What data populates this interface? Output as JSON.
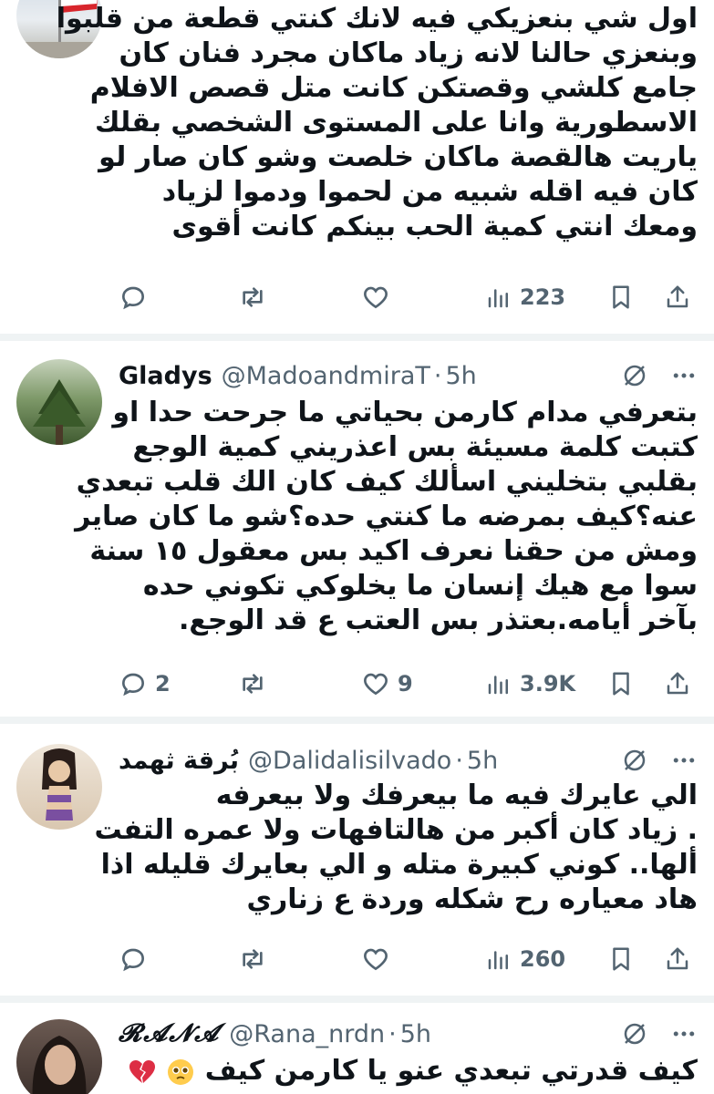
{
  "tweets": [
    {
      "name": "",
      "handle": "",
      "time": "",
      "lines": [
        "اول شي بنعزيكي فيه لانك كنتي قطعة من قلبوا",
        "وبنعزي حالنا لانه زياد ماكان مجرد فنان كان",
        "جامع كلشي وقصتكن كانت متل قصص الافلام",
        "الاسطورية وانا على المستوى الشخصي بقلك",
        "ياريت  هالقصة ماكان خلصت وشو كان صار لو",
        "كان فيه اقله شبيه من لحموا ودموا لزياد",
        "ومعك انتي كمية الحب بينكم كانت أقوى"
      ],
      "replies": "",
      "reposts": "",
      "likes": "",
      "views": "223"
    },
    {
      "name": "Gladys",
      "handle": "@MadoandmiraT",
      "time": "5h",
      "lines": [
        "بتعرفي مدام كارمن بحياتي ما جرحت حدا او",
        "كتبت كلمة مسيئة  بس اعذريني كمية الوجع",
        "بقلبي بتخليني اسألك كيف كان الك قلب تبعدي",
        "عنه؟كيف بمرضه ما كنتي حده؟شو ما كان صاير",
        "ومش من حقنا نعرف اكيد بس معقول ١٥ سنة",
        "سوا مع هيك إنسان ما يخلوكي تكوني حده",
        "بآخر أيامه.بعتذر بس العتب ع قد الوجع."
      ],
      "replies": "2",
      "reposts": "",
      "likes": "9",
      "views": "3.9K"
    },
    {
      "name": "بُرقة ثهمد",
      "handle": "@Dalidalisilvado",
      "time": "5h",
      "lines": [
        "الي عايرك فيه ما بيعرفك ولا بيعرفه",
        ". زياد كان أكبر من هالتافهات ولا عمره التفت",
        "ألها.. كوني كبيرة متله و الي بعايرك قليله اذا",
        "هاد معياره رح شكله وردة ع زناري"
      ],
      "replies": "",
      "reposts": "",
      "likes": "",
      "views": "260"
    },
    {
      "name": "𝓡𝓐𝓝𝓐",
      "handle": "@Rana_nrdn",
      "time": "5h",
      "lines": [
        "كيف قدرتي تبعدي عنو يا كارمن كيف"
      ]
    }
  ],
  "icons": [
    "reply-icon",
    "repost-icon",
    "like-icon",
    "views-icon",
    "bookmark-icon",
    "share-icon",
    "grok-icon",
    "more-icon",
    "pleading-face-emoji",
    "broken-heart-emoji"
  ],
  "colors": {
    "text": "#0f1419",
    "secondary": "#536471",
    "separator": "#eff3f4"
  }
}
